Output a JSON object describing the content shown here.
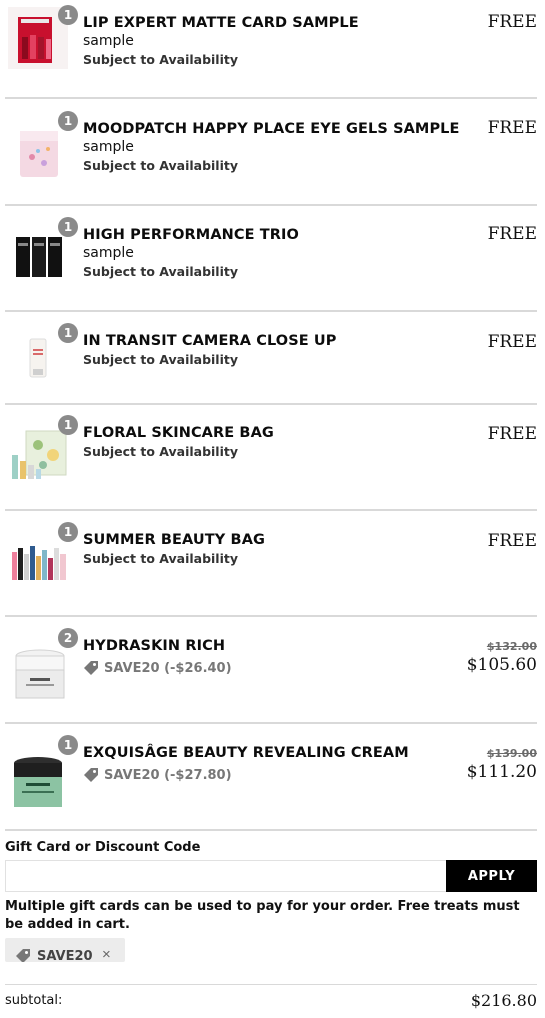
{
  "items": [
    {
      "qty": "1",
      "name": "LIP EXPERT MATTE CARD SAMPLE",
      "sub": "sample",
      "availability": "Subject to Availability",
      "price": "FREE",
      "thumb_icon": "lipstick-card-icon"
    },
    {
      "qty": "1",
      "name": "MOODPATCH HAPPY PLACE EYE GELS SAMPLE",
      "sub": "sample",
      "availability": "Subject to Availability",
      "price": "FREE",
      "thumb_icon": "eye-gel-pack-icon"
    },
    {
      "qty": "1",
      "name": "HIGH PERFORMANCE TRIO",
      "sub": "sample",
      "availability": "Subject to Availability",
      "price": "FREE",
      "thumb_icon": "sachet-trio-icon"
    },
    {
      "qty": "1",
      "name": "IN TRANSIT CAMERA CLOSE UP",
      "availability": "Subject to Availability",
      "price": "FREE",
      "thumb_icon": "tube-icon"
    },
    {
      "qty": "1",
      "name": "FLORAL SKINCARE BAG",
      "availability": "Subject to Availability",
      "price": "FREE",
      "thumb_icon": "floral-bag-icon"
    },
    {
      "qty": "1",
      "name": "SUMMER BEAUTY BAG",
      "availability": "Subject to Availability",
      "price": "FREE",
      "thumb_icon": "beauty-bag-icon"
    },
    {
      "qty": "2",
      "name": "HYDRASKIN RICH",
      "promo": "SAVE20 (-$26.40)",
      "original_price": "$132.00",
      "price": "$105.60",
      "thumb_icon": "cream-jar-white-icon"
    },
    {
      "qty": "1",
      "name": "EXQUISÂGE BEAUTY REVEALING CREAM",
      "promo": "SAVE20 (-$27.80)",
      "original_price": "$139.00",
      "price": "$111.20",
      "thumb_icon": "cream-jar-green-icon"
    }
  ],
  "gift": {
    "label": "Gift Card or Discount Code",
    "placeholder": "",
    "apply_label": "APPLY",
    "note": "Multiple gift cards can be used to pay for your order. Free treats must be added in cart.",
    "applied_code": "SAVE20",
    "remove_glyph": "×"
  },
  "summary": {
    "subtotal_label": "subtotal:",
    "subtotal_value": "$216.80"
  },
  "colors": {
    "qty_badge": "#8a8a8a",
    "apply_button": "#000000",
    "divider": "#d9d9d9",
    "chip_bg": "#ececec"
  }
}
